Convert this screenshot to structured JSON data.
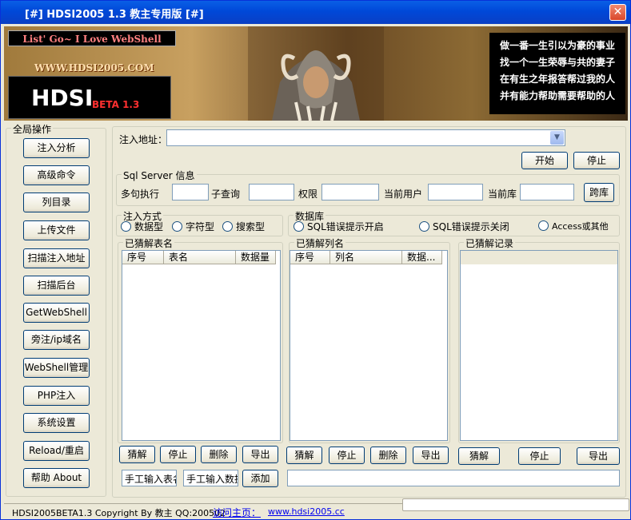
{
  "window": {
    "title": "[#] HDSI2005 1.3 教主专用版 [#]",
    "close": "✕"
  },
  "banner": {
    "slogan": "List' Go~ I Love WebShell",
    "site": "WWW.HDSI2005.COM",
    "logo": "HDSI",
    "beta": "BETA 1.3",
    "poem": [
      "做一番一生引以为豪的事业",
      "找一个一生荣辱与共的妻子",
      "在有生之年报答帮过我的人",
      "并有能力帮助需要帮助的人"
    ]
  },
  "sidebar": {
    "title": "全局操作",
    "items": [
      "注入分析",
      "高级命令",
      "列目录",
      "上传文件",
      "扫描注入地址",
      "扫描后台",
      "GetWebShell",
      "旁注/ip域名",
      "WebShell管理",
      "PHP注入",
      "系统设置",
      "Reload/重启",
      "帮助 About"
    ]
  },
  "main": {
    "url_label": "注入地址：",
    "url_value": "",
    "start": "开始",
    "stop": "停止",
    "sqlserver": {
      "title": "Sql Server 信息",
      "multi": "多句执行",
      "subquery": "子查询",
      "perm": "权限",
      "user": "当前用户",
      "db": "当前库",
      "crossdb": "跨库"
    },
    "inject": {
      "title": "注入方式",
      "options": [
        "数据型",
        "字符型",
        "搜索型"
      ]
    },
    "database": {
      "title": "数据库",
      "options": [
        "SQL错误提示开启",
        "SQL错误提示关闭",
        "Access或其他"
      ]
    },
    "tables": {
      "title": "已猜解表名",
      "cols": [
        "序号",
        "表名",
        "数据量"
      ]
    },
    "columns": {
      "title": "已猜解列名",
      "cols": [
        "序号",
        "列名",
        "数据..."
      ]
    },
    "records": {
      "title": "已猜解记录"
    },
    "btns_tables": [
      "猜解",
      "停止",
      "删除",
      "导出"
    ],
    "btns_columns": [
      "猜解",
      "停止",
      "删除",
      "导出"
    ],
    "btns_records": [
      "猜解",
      "停止",
      "导出"
    ],
    "manual_table": "手工输入表名",
    "manual_data": "手工输入数据",
    "add": "添加"
  },
  "status": {
    "copyright": "HDSI2005BETA1.3 Copyright By 教主 QQ:200502",
    "visit": "访问主页：",
    "url": "www.hdsi2005.cc"
  }
}
